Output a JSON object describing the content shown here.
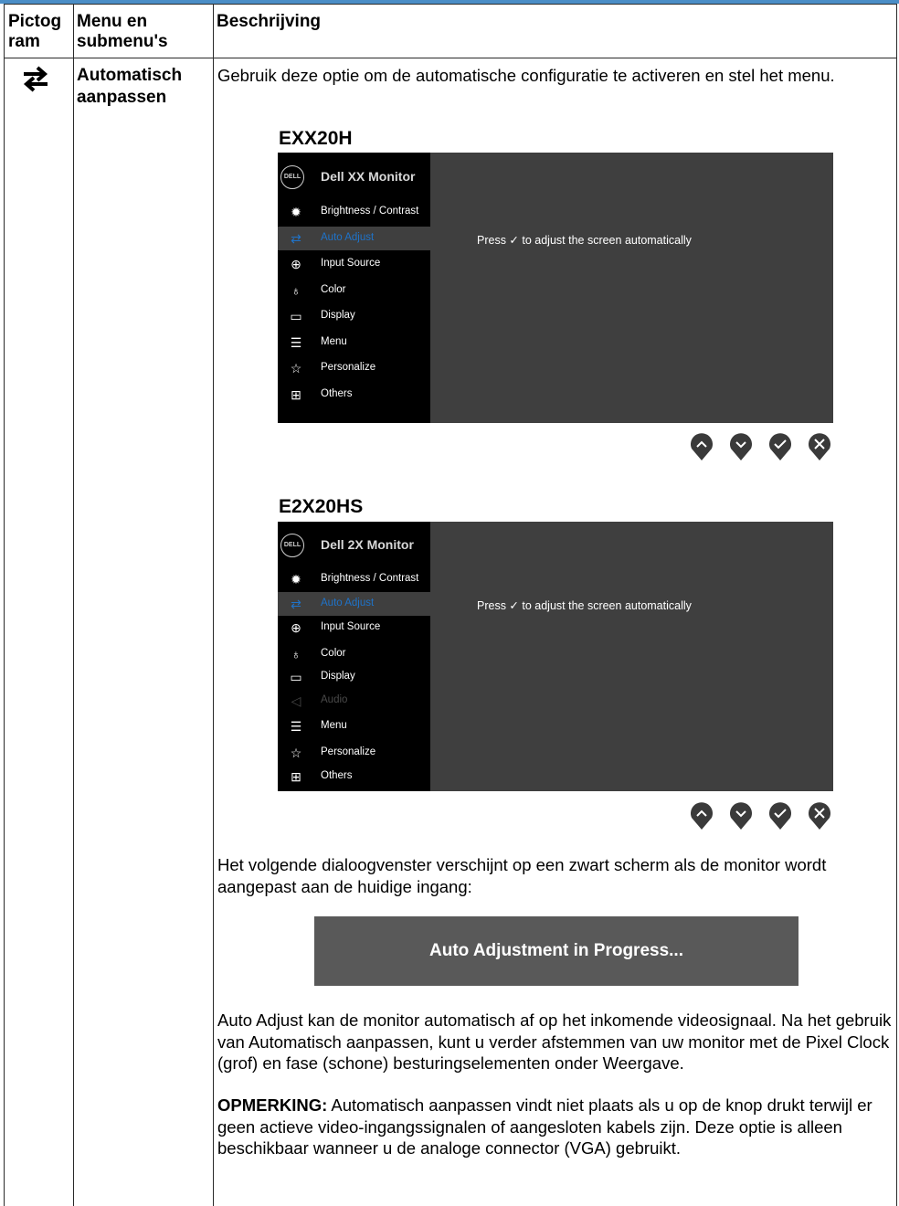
{
  "table": {
    "headers": {
      "pictogram": "Pictog\nram",
      "menu": "Menu en\nsubmenu's",
      "description": "Beschrijving"
    },
    "row": {
      "icon": "auto-adjust-arrows-icon",
      "menu_label": "Automatisch aanpassen",
      "intro": "Gebruik deze optie om de automatische configuratie te activeren en stel het menu.",
      "dialog_intro": "Het volgende dialoogvenster verschijnt op een zwart scherm als de monitor wordt aangepast aan de huidige ingang:",
      "explanation": "Auto Adjust kan de monitor automatisch af op het inkomende videosignaal. Na het gebruik van Automatisch aanpassen, kunt u verder afstemmen van uw monitor met de Pixel Clock (grof) en fase (schone) besturingselementen onder Weergave.",
      "note_label": "OPMERKING:",
      "note_text": " Automatisch aanpassen vindt niet plaats als u op de knop drukt terwijl er geen actieve video-ingangssignalen of aangesloten kabels zijn. Deze optie is alleen beschikbaar wanneer u de analoge connector (VGA) gebruikt."
    }
  },
  "osd_screens": [
    {
      "model": "EXX20H",
      "logo": "DELL",
      "title": "Dell XX Monitor",
      "message": "Press ✓ to adjust the screen automatically",
      "items": [
        {
          "label": "Brightness / Contrast",
          "icon": "brightness-icon",
          "state": "normal"
        },
        {
          "label": "Auto Adjust",
          "icon": "auto-adjust-icon",
          "state": "selected"
        },
        {
          "label": "Input Source",
          "icon": "input-source-icon",
          "state": "normal"
        },
        {
          "label": "Color",
          "icon": "color-icon",
          "state": "normal"
        },
        {
          "label": "Display",
          "icon": "display-icon",
          "state": "normal"
        },
        {
          "label": "Menu",
          "icon": "menu-icon",
          "state": "normal"
        },
        {
          "label": "Personalize",
          "icon": "star-icon",
          "state": "normal"
        },
        {
          "label": "Others",
          "icon": "others-icon",
          "state": "normal"
        }
      ]
    },
    {
      "model": "E2X20HS",
      "logo": "DELL",
      "title": "Dell 2X Monitor",
      "message": "Press ✓ to adjust the screen automatically",
      "items": [
        {
          "label": "Brightness / Contrast",
          "icon": "brightness-icon",
          "state": "normal"
        },
        {
          "label": "Auto Adjust",
          "icon": "auto-adjust-icon",
          "state": "selected"
        },
        {
          "label": "Input Source",
          "icon": "input-source-icon",
          "state": "normal"
        },
        {
          "label": "Color",
          "icon": "color-icon",
          "state": "normal"
        },
        {
          "label": "Display",
          "icon": "display-icon",
          "state": "normal"
        },
        {
          "label": "Audio",
          "icon": "speaker-icon",
          "state": "disabled"
        },
        {
          "label": "Menu",
          "icon": "menu-icon",
          "state": "normal"
        },
        {
          "label": "Personalize",
          "icon": "star-icon",
          "state": "normal"
        },
        {
          "label": "Others",
          "icon": "others-icon",
          "state": "normal"
        }
      ]
    }
  ],
  "buttons": [
    {
      "icon": "arrow-up-icon"
    },
    {
      "icon": "arrow-down-icon"
    },
    {
      "icon": "checkmark-icon"
    },
    {
      "icon": "close-icon"
    }
  ],
  "progress_dialog": {
    "text": "Auto Adjustment in Progress..."
  },
  "colors": {
    "osd_panel": "#3f3f3f",
    "osd_sidebar": "#000000",
    "osd_selected_text": "#1f73c9",
    "button_fill": "#3a3a3a"
  }
}
